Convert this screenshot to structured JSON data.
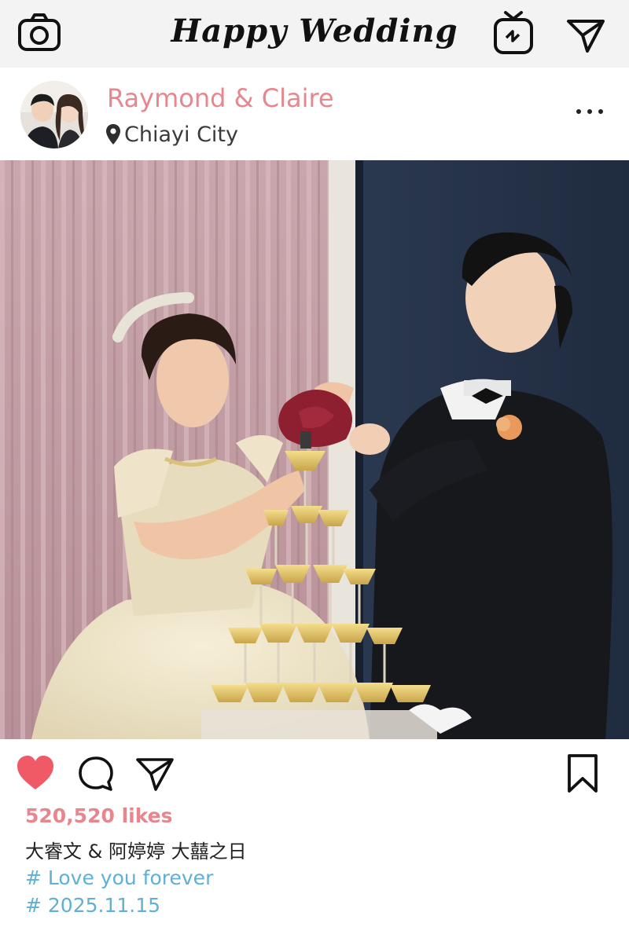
{
  "header": {
    "title": "Happy Wedding",
    "left_icon": "camera-icon",
    "right_icons": [
      "igtv-icon",
      "direct-message-icon"
    ]
  },
  "post": {
    "username": "Raymond & Claire",
    "location": "Chiayi City",
    "more_icon": "more-options-icon"
  },
  "actions": {
    "icons": [
      "heart-icon",
      "comment-icon",
      "share-icon",
      "bookmark-icon"
    ],
    "liked": true
  },
  "caption": {
    "likes": "520,520 likes",
    "text": "大睿文 & 阿婷婷 大囍之日",
    "hashtags": [
      "# Love you forever",
      "# 2025.11.15"
    ]
  },
  "colors": {
    "accent_pink": "#e8868d",
    "heart_red": "#f05a67",
    "hashtag_blue": "#5fb0d6",
    "topbar_bg": "#f3f3f3"
  }
}
